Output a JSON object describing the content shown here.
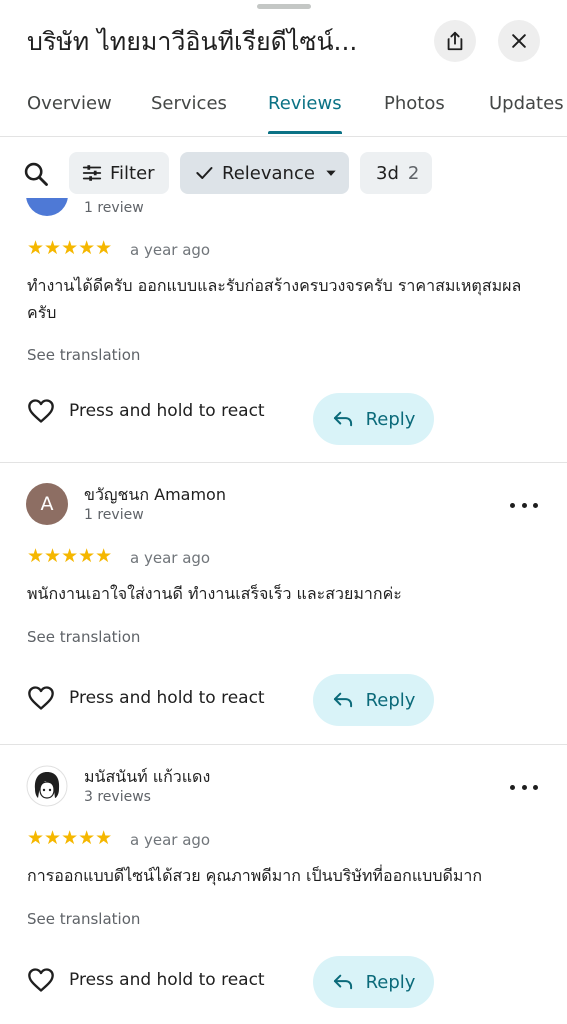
{
  "header": {
    "title": "บริษัท ไทยมาวีอินทีเรียดีไซน์...",
    "share_icon": "share-icon",
    "close_icon": "close-icon"
  },
  "tabs": [
    {
      "label": "Overview",
      "active": false
    },
    {
      "label": "Services",
      "active": false
    },
    {
      "label": "Reviews",
      "active": true
    },
    {
      "label": "Photos",
      "active": false
    },
    {
      "label": "Updates",
      "active": false
    }
  ],
  "toolbar": {
    "search_icon": "search-icon",
    "filter_label": "Filter",
    "sort_label": "Relevance",
    "chip3_label": "3d",
    "chip3_count": "2"
  },
  "reviews": [
    {
      "name": "",
      "review_count": "1 review",
      "avatar_letter": "",
      "stars": "★★★★★",
      "rating": 5,
      "date": "a year ago",
      "text": "ทำงานได้ดีครับ ออกแบบและรับก่อสร้างครบวงจรครับ ราคาสมเหตุสมผลครับ",
      "see_translation": "See translation",
      "react_label": "Press and hold to react",
      "reply_label": "Reply"
    },
    {
      "name": "ขวัญชนก Amamon",
      "review_count": "1 review",
      "avatar_letter": "A",
      "stars": "★★★★★",
      "rating": 5,
      "date": "a year ago",
      "text": "พนักงานเอาใจใส่งานดี ทำงานเสร็จเร็ว และสวยมากค่ะ",
      "see_translation": "See translation",
      "react_label": "Press and hold to react",
      "reply_label": "Reply"
    },
    {
      "name": "มนัสนันท์ แก้วแดง",
      "review_count": "3 reviews",
      "avatar_letter": "",
      "stars": "★★★★★",
      "rating": 5,
      "date": "a year ago",
      "text": "การออกแบบดีไซน์ได้สวย คุณภาพดีมาก เป็นบริษัทที่ออกแบบดีมาก",
      "see_translation": "See translation",
      "react_label": "Press and hold to react",
      "reply_label": "Reply"
    }
  ],
  "colors": {
    "accent": "#0b7285",
    "star": "#f5b700",
    "reply_bg": "#d9f3f8",
    "chip_bg": "#edf0f2",
    "avatar_a": "#8d6e63",
    "avatar_blue": "#4e79d6"
  }
}
